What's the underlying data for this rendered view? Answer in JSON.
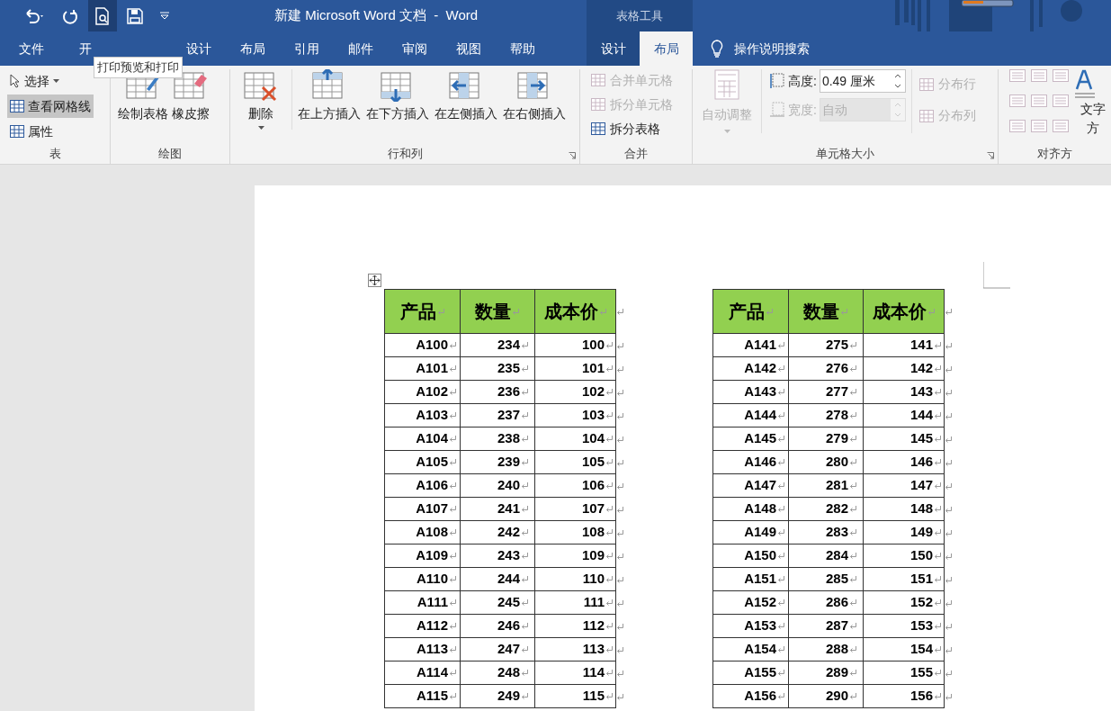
{
  "window": {
    "title": "新建 Microsoft Word 文档  -  Word",
    "context_tab": "表格工具"
  },
  "quick_access": [
    {
      "kind": "undo",
      "selected": false
    },
    {
      "kind": "redo",
      "selected": false
    },
    {
      "kind": "preview",
      "selected": true
    },
    {
      "kind": "save",
      "selected": false
    },
    {
      "kind": "customize",
      "selected": false
    }
  ],
  "tooltip": "打印预览和打印",
  "tabs": [
    {
      "label": "文件"
    },
    {
      "label": "开"
    },
    {
      "label": "设计"
    },
    {
      "label": "布局"
    },
    {
      "label": "引用"
    },
    {
      "label": "邮件"
    },
    {
      "label": "审阅"
    },
    {
      "label": "视图"
    },
    {
      "label": "帮助"
    }
  ],
  "context_tabs": [
    {
      "label": "设计",
      "selected": false
    },
    {
      "label": "布局",
      "selected": true
    }
  ],
  "search": {
    "placeholder": "操作说明搜索"
  },
  "ribbon": {
    "table_group": {
      "label": "表",
      "items": [
        {
          "label": "选择",
          "selected": false,
          "kind": "select"
        },
        {
          "label": "查看网格线",
          "selected": true,
          "kind": "grid"
        },
        {
          "label": "属性",
          "selected": false,
          "kind": "props"
        }
      ]
    },
    "draw_group": {
      "label": "绘图",
      "items": [
        {
          "label": "绘制表格",
          "kind": "draw"
        },
        {
          "label": "橡皮擦",
          "kind": "eraser"
        }
      ]
    },
    "rows_group": {
      "label": "行和列",
      "delete": "删除",
      "items": [
        {
          "label": "在上方插入",
          "kind": "above"
        },
        {
          "label": "在下方插入",
          "kind": "below"
        },
        {
          "label": "在左侧插入",
          "kind": "left"
        },
        {
          "label": "在右侧插入",
          "kind": "right"
        }
      ]
    },
    "merge_group": {
      "label": "合并",
      "items": [
        {
          "label": "合并单元格",
          "disabled": true
        },
        {
          "label": "拆分单元格",
          "disabled": true
        },
        {
          "label": "拆分表格",
          "disabled": false
        }
      ]
    },
    "size_group": {
      "label": "单元格大小",
      "autofit": {
        "label": "自动调整",
        "disabled": true
      },
      "height": {
        "label": "高度:",
        "value": "0.49 厘米",
        "disabled": false
      },
      "width": {
        "label": "宽度:",
        "value": "自动",
        "disabled": true
      },
      "distribute": [
        {
          "label": "分布行",
          "disabled": true
        },
        {
          "label": "分布列",
          "disabled": true
        }
      ]
    },
    "align_group": {
      "label": "对齐方",
      "direction": "文字方"
    }
  },
  "tables": [
    {
      "columns": [
        "产品",
        "数量",
        "成本价"
      ],
      "rows": [
        [
          "A100",
          "234",
          "100"
        ],
        [
          "A101",
          "235",
          "101"
        ],
        [
          "A102",
          "236",
          "102"
        ],
        [
          "A103",
          "237",
          "103"
        ],
        [
          "A104",
          "238",
          "104"
        ],
        [
          "A105",
          "239",
          "105"
        ],
        [
          "A106",
          "240",
          "106"
        ],
        [
          "A107",
          "241",
          "107"
        ],
        [
          "A108",
          "242",
          "108"
        ],
        [
          "A109",
          "243",
          "109"
        ],
        [
          "A110",
          "244",
          "110"
        ],
        [
          "A111",
          "245",
          "111"
        ],
        [
          "A112",
          "246",
          "112"
        ],
        [
          "A113",
          "247",
          "113"
        ],
        [
          "A114",
          "248",
          "114"
        ],
        [
          "A115",
          "249",
          "115"
        ]
      ]
    },
    {
      "columns": [
        "产品",
        "数量",
        "成本价"
      ],
      "rows": [
        [
          "A141",
          "275",
          "141"
        ],
        [
          "A142",
          "276",
          "142"
        ],
        [
          "A143",
          "277",
          "143"
        ],
        [
          "A144",
          "278",
          "144"
        ],
        [
          "A145",
          "279",
          "145"
        ],
        [
          "A146",
          "280",
          "146"
        ],
        [
          "A147",
          "281",
          "147"
        ],
        [
          "A148",
          "282",
          "148"
        ],
        [
          "A149",
          "283",
          "149"
        ],
        [
          "A150",
          "284",
          "150"
        ],
        [
          "A151",
          "285",
          "151"
        ],
        [
          "A152",
          "286",
          "152"
        ],
        [
          "A153",
          "287",
          "153"
        ],
        [
          "A154",
          "288",
          "154"
        ],
        [
          "A155",
          "289",
          "155"
        ],
        [
          "A156",
          "290",
          "156"
        ]
      ]
    }
  ]
}
